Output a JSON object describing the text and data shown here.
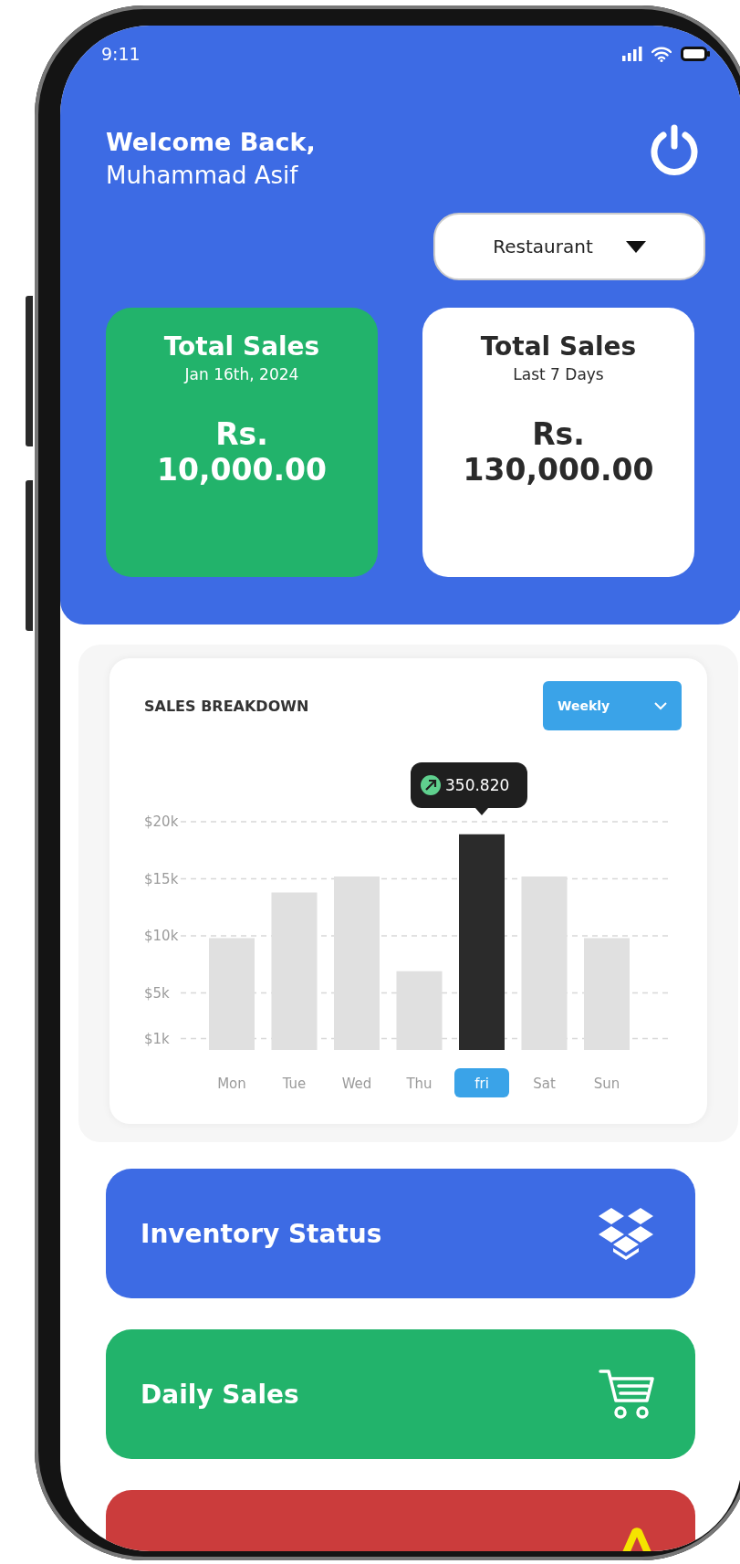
{
  "status_bar": {
    "time": "9:11"
  },
  "header": {
    "greeting": "Welcome Back,",
    "user_name": "Muhammad Asif",
    "business_dropdown": {
      "value": "Restaurant"
    }
  },
  "summary_cards": [
    {
      "kind": "highlight",
      "title": "Total Sales",
      "period": "Jan 16th, 2024",
      "currency": "Rs.",
      "amount": "10,000.00"
    },
    {
      "kind": "plain",
      "title": "Total Sales",
      "period": "Last 7 Days",
      "currency": "Rs.",
      "amount": "130,000.00"
    }
  ],
  "sales_breakdown": {
    "title": "SALES BREAKDOWN",
    "period_dropdown": {
      "value": "Weekly"
    },
    "tooltip": {
      "value": "350.820"
    },
    "days": [
      {
        "selected": false,
        "color": "#e0e0e0"
      },
      {
        "selected": false,
        "color": "#e0e0e0"
      },
      {
        "selected": false,
        "color": "#e0e0e0"
      },
      {
        "selected": false,
        "color": "#e0e0e0"
      },
      {
        "selected": true,
        "color": "#2b2b2b"
      },
      {
        "selected": false,
        "color": "#e0e0e0"
      },
      {
        "selected": false,
        "color": "#e0e0e0"
      }
    ],
    "chart_data": {
      "type": "bar",
      "categories": [
        "Mon",
        "Tue",
        "Wed",
        "Thu",
        "fri",
        "Sat",
        "Sun"
      ],
      "series": [
        {
          "values": [
            9800,
            13800,
            15200,
            6900,
            18900,
            15200,
            9800
          ]
        }
      ],
      "ylim": [
        0,
        20000
      ],
      "grid": true,
      "yticks": [
        {
          "value": 20000,
          "label": "$20k"
        },
        {
          "value": 15000,
          "label": "$15k"
        },
        {
          "value": 10000,
          "label": "$10k"
        },
        {
          "value": 5000,
          "label": "$5k"
        },
        {
          "value": 1000,
          "label": "$1k"
        }
      ]
    }
  },
  "action_cards": [
    {
      "kind": "inventory",
      "label": "Inventory Status"
    },
    {
      "kind": "sales",
      "label": "Daily Sales"
    },
    {
      "kind": "risk"
    }
  ]
}
